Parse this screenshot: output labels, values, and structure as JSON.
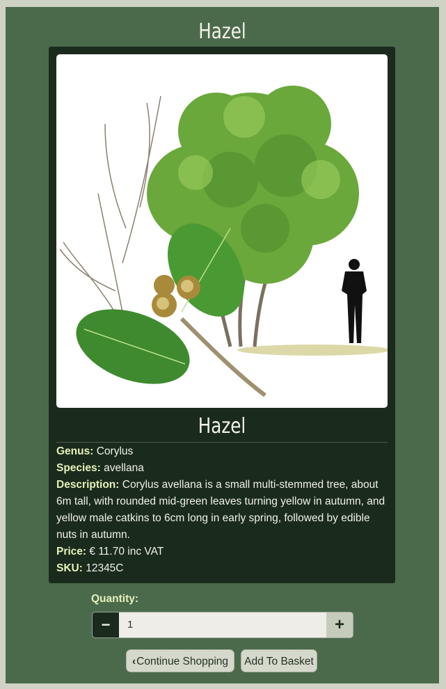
{
  "page": {
    "title": "Hazel"
  },
  "product": {
    "name": "Hazel",
    "image_alt": "Hazel tree illustration",
    "genus_label": "Genus:",
    "genus": "Corylus",
    "species_label": "Species:",
    "species": "avellana",
    "description_label": "Description:",
    "description": "Corylus avellana is a small multi-stemmed tree, about 6m tall, with rounded mid-green leaves turning yellow in autumn, and yellow male catkins to 6cm long in early spring, followed by edible nuts in autumn.",
    "price_label": "Price:",
    "price": "€ 11.70 inc VAT",
    "sku_label": "SKU:",
    "sku": "12345C"
  },
  "quantity": {
    "label": "Quantity:",
    "value": "1",
    "minus": "−",
    "plus": "+"
  },
  "actions": {
    "continue_label": "Continue Shopping",
    "add_label": "Add To Basket"
  },
  "colors": {
    "background": "#4b6a4c",
    "card": "#1a2b1d",
    "label": "#e6f0b9"
  }
}
